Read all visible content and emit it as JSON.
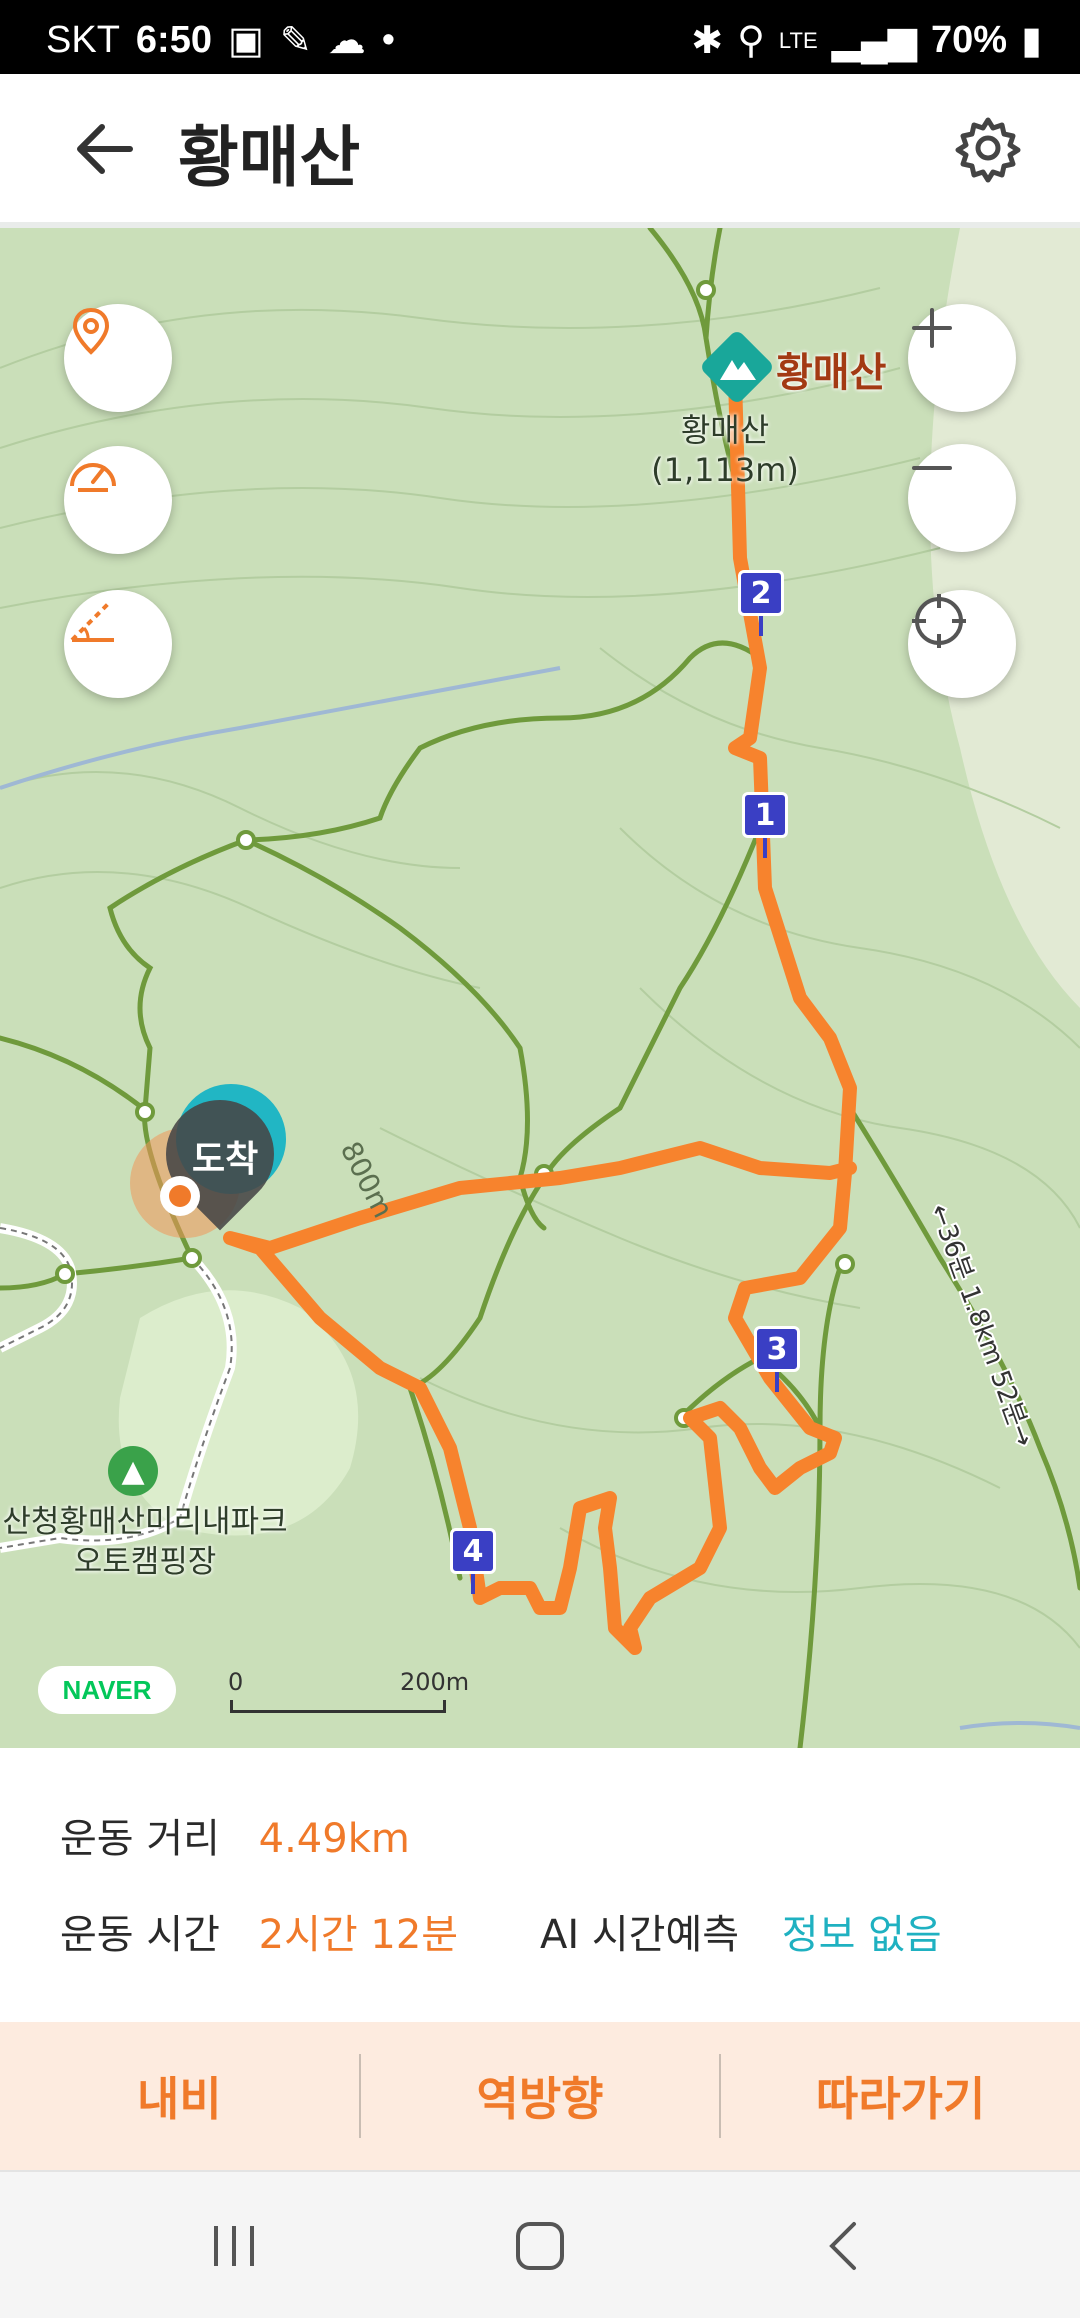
{
  "status_bar": {
    "carrier": "SKT",
    "time": "6:50",
    "network": "LTE",
    "battery": "70%"
  },
  "header": {
    "title": "황매산",
    "back_icon": "arrow-left-icon",
    "settings_icon": "gear-icon"
  },
  "map": {
    "peak_name": "황매산",
    "peak_label_line1": "황매산",
    "peak_label_line2": "(1,113m)",
    "arrival_label": "도착",
    "contour_label": "800m",
    "campsite_line1": "산청황매산미리내파크",
    "campsite_line2": "오토캠핑장",
    "trail_info": "←36분 1.8km 52분→",
    "waypoints": [
      "1",
      "2",
      "3",
      "4"
    ],
    "scale": {
      "start": "0",
      "end": "200m"
    },
    "brand": "NAVER",
    "route_color": "#f7832d"
  },
  "stats": {
    "distance_label": "운동 거리",
    "distance_value": "4.49km",
    "time_label": "운동 시간",
    "time_value": "2시간 12분",
    "ai_label": "AI 시간예측",
    "ai_value": "정보 없음"
  },
  "actions": {
    "navigate": "내비",
    "reverse": "역방향",
    "follow": "따라가기"
  }
}
